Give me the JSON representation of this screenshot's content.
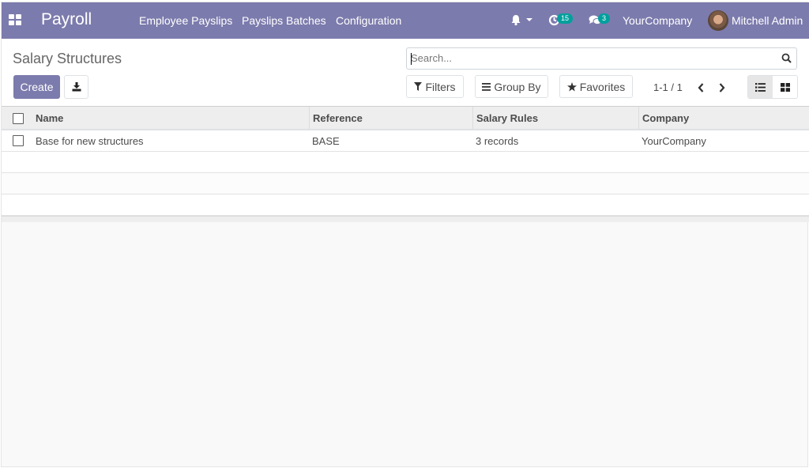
{
  "navbar": {
    "app_name": "Payroll",
    "menu": [
      "Employee Payslips",
      "Payslips Batches",
      "Configuration"
    ],
    "activity_count": "15",
    "message_count": "3",
    "company": "YourCompany",
    "user": "Mitchell Admin"
  },
  "control_panel": {
    "title": "Salary Structures",
    "create_label": "Create",
    "search_placeholder": "Search...",
    "filters_label": "Filters",
    "group_by_label": "Group By",
    "favorites_label": "Favorites",
    "pager": "1-1 / 1"
  },
  "table": {
    "columns": [
      "Name",
      "Reference",
      "Salary Rules",
      "Company"
    ],
    "rows": [
      {
        "name": "Base for new structures",
        "reference": "BASE",
        "salary_rules": "3 records",
        "company": "YourCompany"
      }
    ]
  },
  "colors": {
    "brand": "#7c7bad",
    "badge": "#00a09d"
  }
}
